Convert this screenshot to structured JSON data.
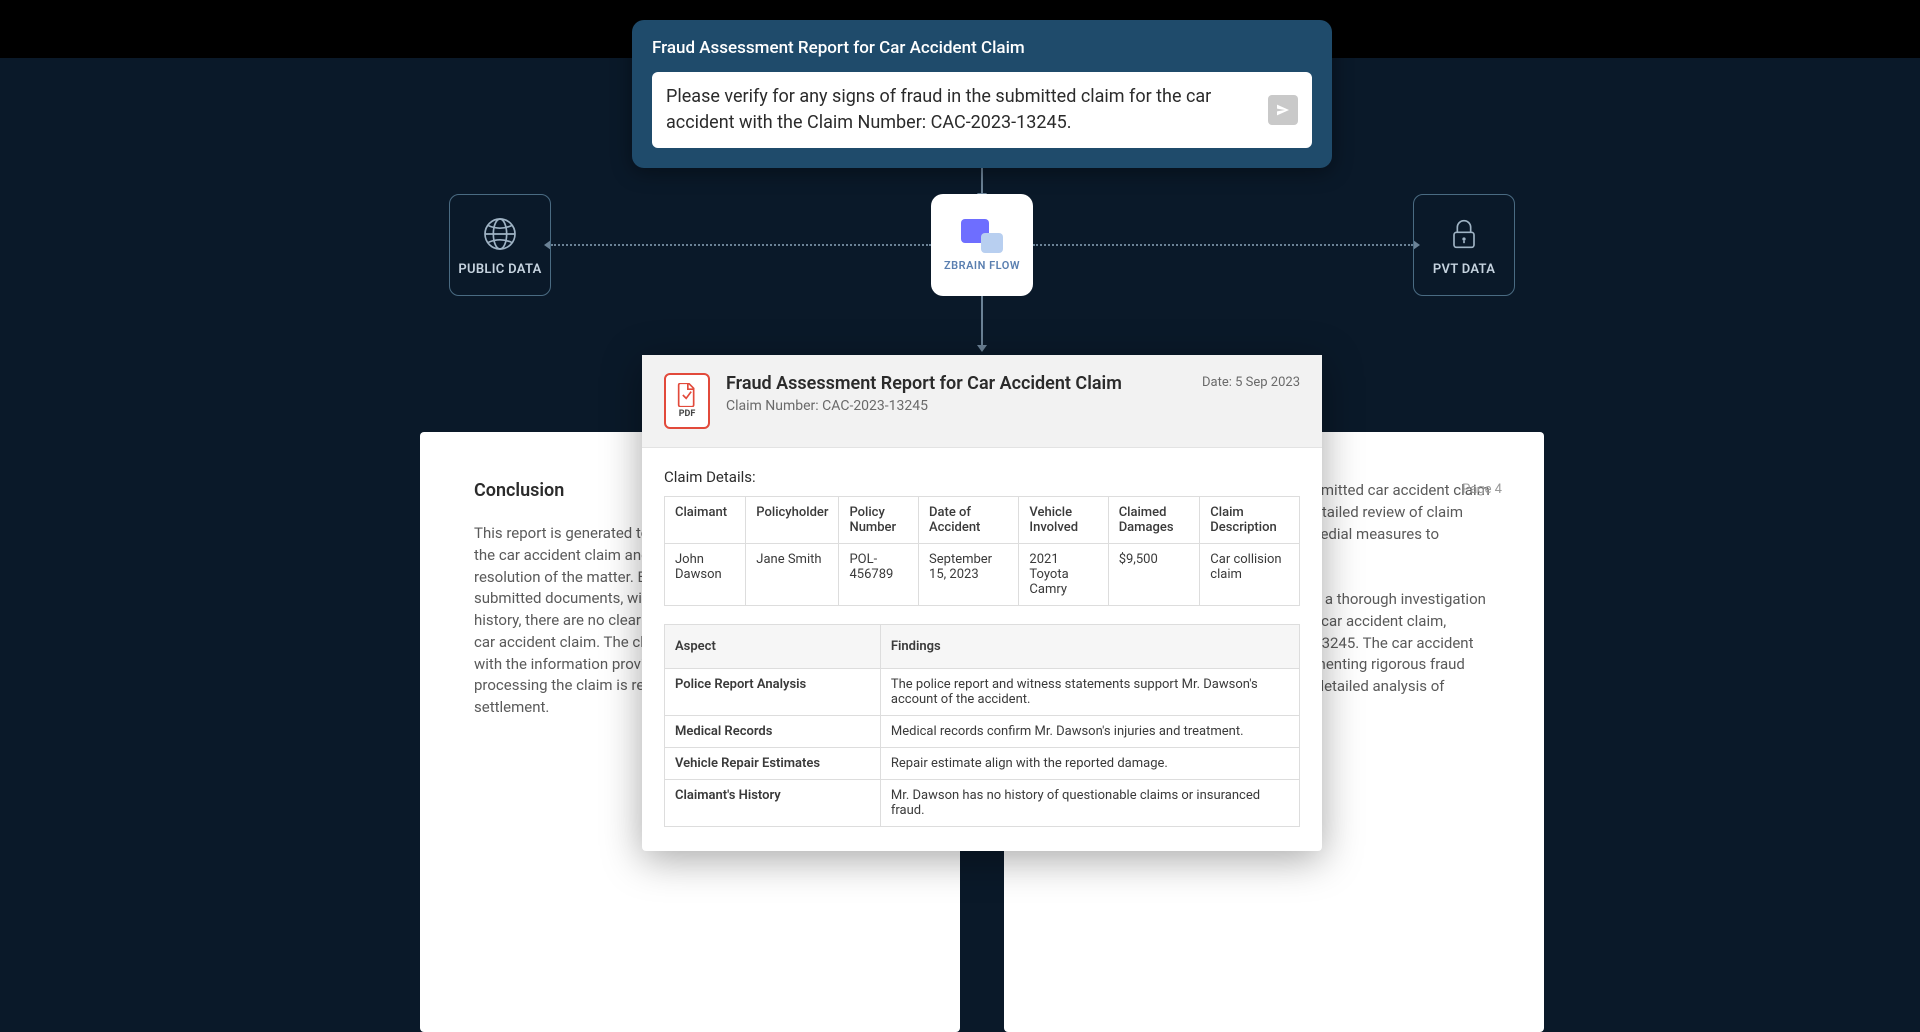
{
  "input_card": {
    "title": "Fraud Assessment Report for Car Accident Claim",
    "prompt": "Please verify for any signs of fraud in the submitted claim for the car accident with the Claim Number: CAC-2023-13245."
  },
  "nodes": {
    "public_data": "PUBLIC DATA",
    "private_data": "PVT DATA",
    "center_brand": "ZBRAIN FLOW"
  },
  "bg_left": {
    "heading": "Conclusion",
    "text": "This report is generated to assist in the objective evaluation of the car accident claim and to ensure a fair and efficient resolution of the matter. Based on the thorough review of all submitted documents, witness statements, and the claimant's history, there are no clear indications of fraud in the submitted car accident claim. The claim appears to be genuine and aligns with the information provided in the documents. Therefore, processing the claim is recommended for further evaluation and settlement."
  },
  "bg_right": {
    "page": "Page 4",
    "text1": "This comprehensive analysis of the submitted car accident claim number: CAC-2023-13245. It offers a detailed review of claim specifics, findings, procedures, and remedial measures to facilitate the claim processing.",
    "text2": "The purpose of this report is to conduct a thorough investigation for potential fraud within the submitted car accident claim, identified by Claim Number CAC-2023-13245. The car accident claim is thoroughly examined by implementing rigorous fraud detection processes and conducting a detailed analysis of statements provided by the claimants."
  },
  "report": {
    "header_title": "Fraud Assessment Report for Car Accident Claim",
    "header_subtitle": "Claim Number: CAC-2023-13245",
    "date": "Date: 5 Sep 2023",
    "pdf_label": "PDF",
    "claim_details_label": "Claim Details:",
    "claim_headers": [
      "Claimant",
      "Policyholder",
      "Policy Number",
      "Date of Accident",
      "Vehicle Involved",
      "Claimed Damages",
      "Claim Description"
    ],
    "claim_row": [
      "John Dawson",
      "Jane Smith",
      "POL-456789",
      "September 15, 2023",
      "2021 Toyota Camry",
      "$9,500",
      "Car collision claim"
    ],
    "findings_headers": [
      "Aspect",
      "Findings"
    ],
    "findings": [
      {
        "aspect": "Police Report Analysis",
        "finding": "The police report and witness statements support Mr. Dawson's account of the accident."
      },
      {
        "aspect": "Medical Records",
        "finding": "Medical records confirm Mr. Dawson's injuries and treatment."
      },
      {
        "aspect": "Vehicle Repair Estimates",
        "finding": "Repair estimate align with the reported damage."
      },
      {
        "aspect": "Claimant's History",
        "finding": "Mr. Dawson has no history of questionable claims or insuranced fraud."
      }
    ]
  }
}
